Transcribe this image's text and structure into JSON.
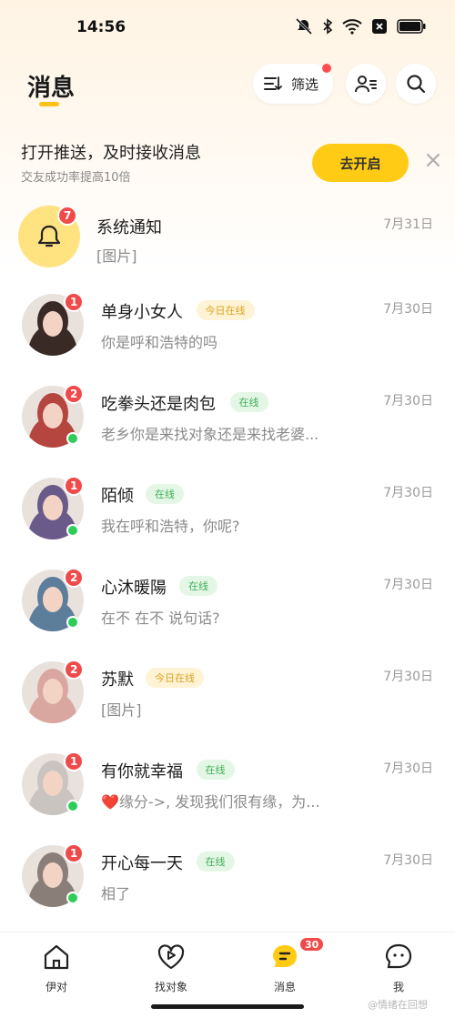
{
  "status_bar": {
    "time": "14:56"
  },
  "header": {
    "title": "消息",
    "filter_label": "筛选"
  },
  "push_banner": {
    "title": "打开推送，及时接收消息",
    "subtitle": "交友成功率提高10倍",
    "enable_label": "去开启"
  },
  "system_notice": {
    "name": "系统通知",
    "preview": "[图片]",
    "date": "7月31日",
    "badge": "7"
  },
  "conversations": [
    {
      "name": "单身小女人",
      "tag": "今日在线",
      "tag_type": "today",
      "preview": "你是呼和浩特的吗",
      "date": "7月30日",
      "badge": "1",
      "online": false,
      "avatar_color": "#3a2a25"
    },
    {
      "name": "吃拳头还是肉包",
      "tag": "在线",
      "tag_type": "online",
      "preview": "老乡你是来找对象还是来找老婆...",
      "date": "7月30日",
      "badge": "2",
      "online": true,
      "avatar_color": "#b5463f"
    },
    {
      "name": "陌倾",
      "tag": "在线",
      "tag_type": "online",
      "preview": "我在呼和浩特，你呢?",
      "date": "7月30日",
      "badge": "1",
      "online": true,
      "avatar_color": "#6a5a8a"
    },
    {
      "name": "心沐暖陽",
      "tag": "在线",
      "tag_type": "online",
      "preview": "在不 在不 说句话?",
      "date": "7月30日",
      "badge": "2",
      "online": true,
      "avatar_color": "#5d7e9a"
    },
    {
      "name": "苏默",
      "tag": "今日在线",
      "tag_type": "today",
      "preview": "[图片]",
      "date": "7月30日",
      "badge": "2",
      "online": false,
      "avatar_color": "#d9a7a0"
    },
    {
      "name": "有你就幸福",
      "tag": "在线",
      "tag_type": "online",
      "preview": "缘分->, 发现我们很有缘，为...",
      "preview_icon": "❤️",
      "date": "7月30日",
      "badge": "1",
      "online": true,
      "avatar_color": "#c9c4c0"
    },
    {
      "name": "开心每一天",
      "tag": "在线",
      "tag_type": "online",
      "preview": "相了",
      "date": "7月30日",
      "badge": "1",
      "online": true,
      "avatar_color": "#8a7f78"
    }
  ],
  "bottom_nav": {
    "items": [
      {
        "label": "伊对",
        "icon": "home-icon"
      },
      {
        "label": "找对象",
        "icon": "heart-play-icon"
      },
      {
        "label": "消息",
        "icon": "message-icon",
        "badge": "30",
        "active": true
      },
      {
        "label": "我",
        "icon": "profile-face-icon"
      }
    ]
  },
  "watermark": "@情绪在回想"
}
